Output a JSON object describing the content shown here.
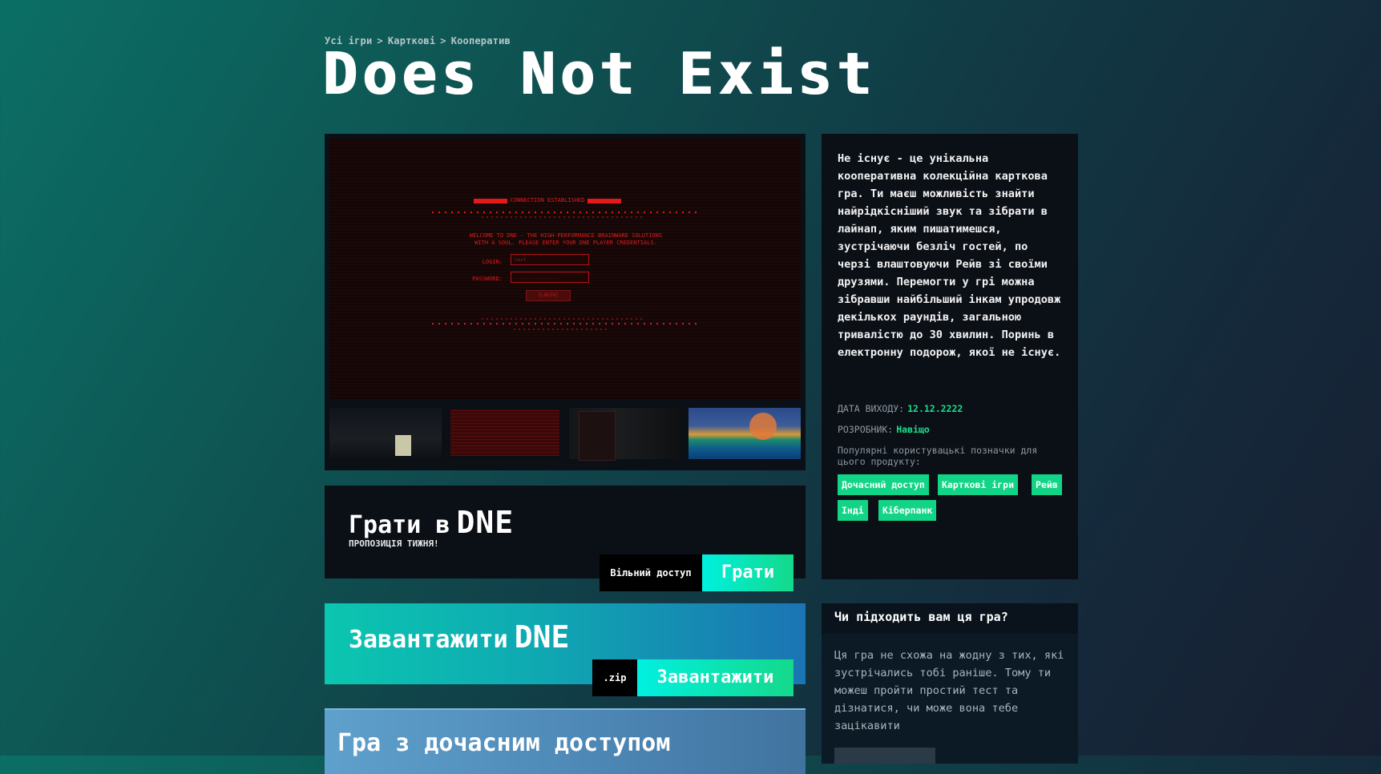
{
  "breadcrumb": {
    "items": [
      "Усі ігри",
      "Карткові",
      "Кооператив"
    ],
    "separator": ">"
  },
  "game": {
    "title": "Does Not Exist"
  },
  "screenshot": {
    "banner": "CONNECTION ESTABLISHED",
    "welcome_line1": "WELCOME TO DNE - THE HIGH-PERFORMANCE BRAINWARE SOLUTIONS",
    "welcome_line2": "WITH A SOUL. PLEASE ENTER YOUR DNE PLAYER CREDENTIALS.",
    "login_label": "LOGIN:",
    "login_value": "next",
    "password_label": "PASSWORD:",
    "password_value": "...............",
    "login_button": "[LOGIN]"
  },
  "play": {
    "title": "Грати в",
    "brand": "DNE",
    "subtitle": "ПРОПОЗИЦІЯ ТИЖНЯ!",
    "access_label": "Вільний доступ",
    "button_label": "Грати"
  },
  "download": {
    "title": "Завантажити",
    "brand": "DNE",
    "format_label": ".zip",
    "button_label": "Завантажити"
  },
  "early_access": {
    "title": "Гра з дочасним доступом"
  },
  "info": {
    "description": "Не існує - це унікальна кооперативна колекційна карткова гра. Ти маєш можливість знайти найрідкісніший звук та зібрати в лайнап, яким пишатимешся, зустрічаючи безліч гостей, по черзі влаштовуючи Рейв зі своїми друзями. Перемогти у грі можна зібравши найбільший інкам упродовж декількох раундів, загальною тривалістю до 30 хвилин. Поринь в електронну подорож, якої не існує.",
    "release_label": "ДАТА ВИХОДУ:",
    "release_value": "12.12.2222",
    "developer_label": "РОЗРОБНИК:",
    "developer_value": "Навіщо",
    "popular_tags_label": "Популярні користувацькі позначки для цього продукту:",
    "tags": [
      "Дочасний доступ",
      "Карткові ігри",
      "Рейв",
      "Інді",
      "Кіберпанк"
    ]
  },
  "fit": {
    "title": "Чи підходить вам ця гра?",
    "text": "Ця гра не схожа на жодну з тих, які зустрічались тобі раніше. Тому ти можеш пройти простий тест та дізнатися, чи може вона тебе зацікавити"
  },
  "colors": {
    "accent_green": "#14d98a",
    "accent_cyan": "#00f0e0",
    "card_bg": "#0b0f16",
    "screen_red": "#e21a1a"
  }
}
